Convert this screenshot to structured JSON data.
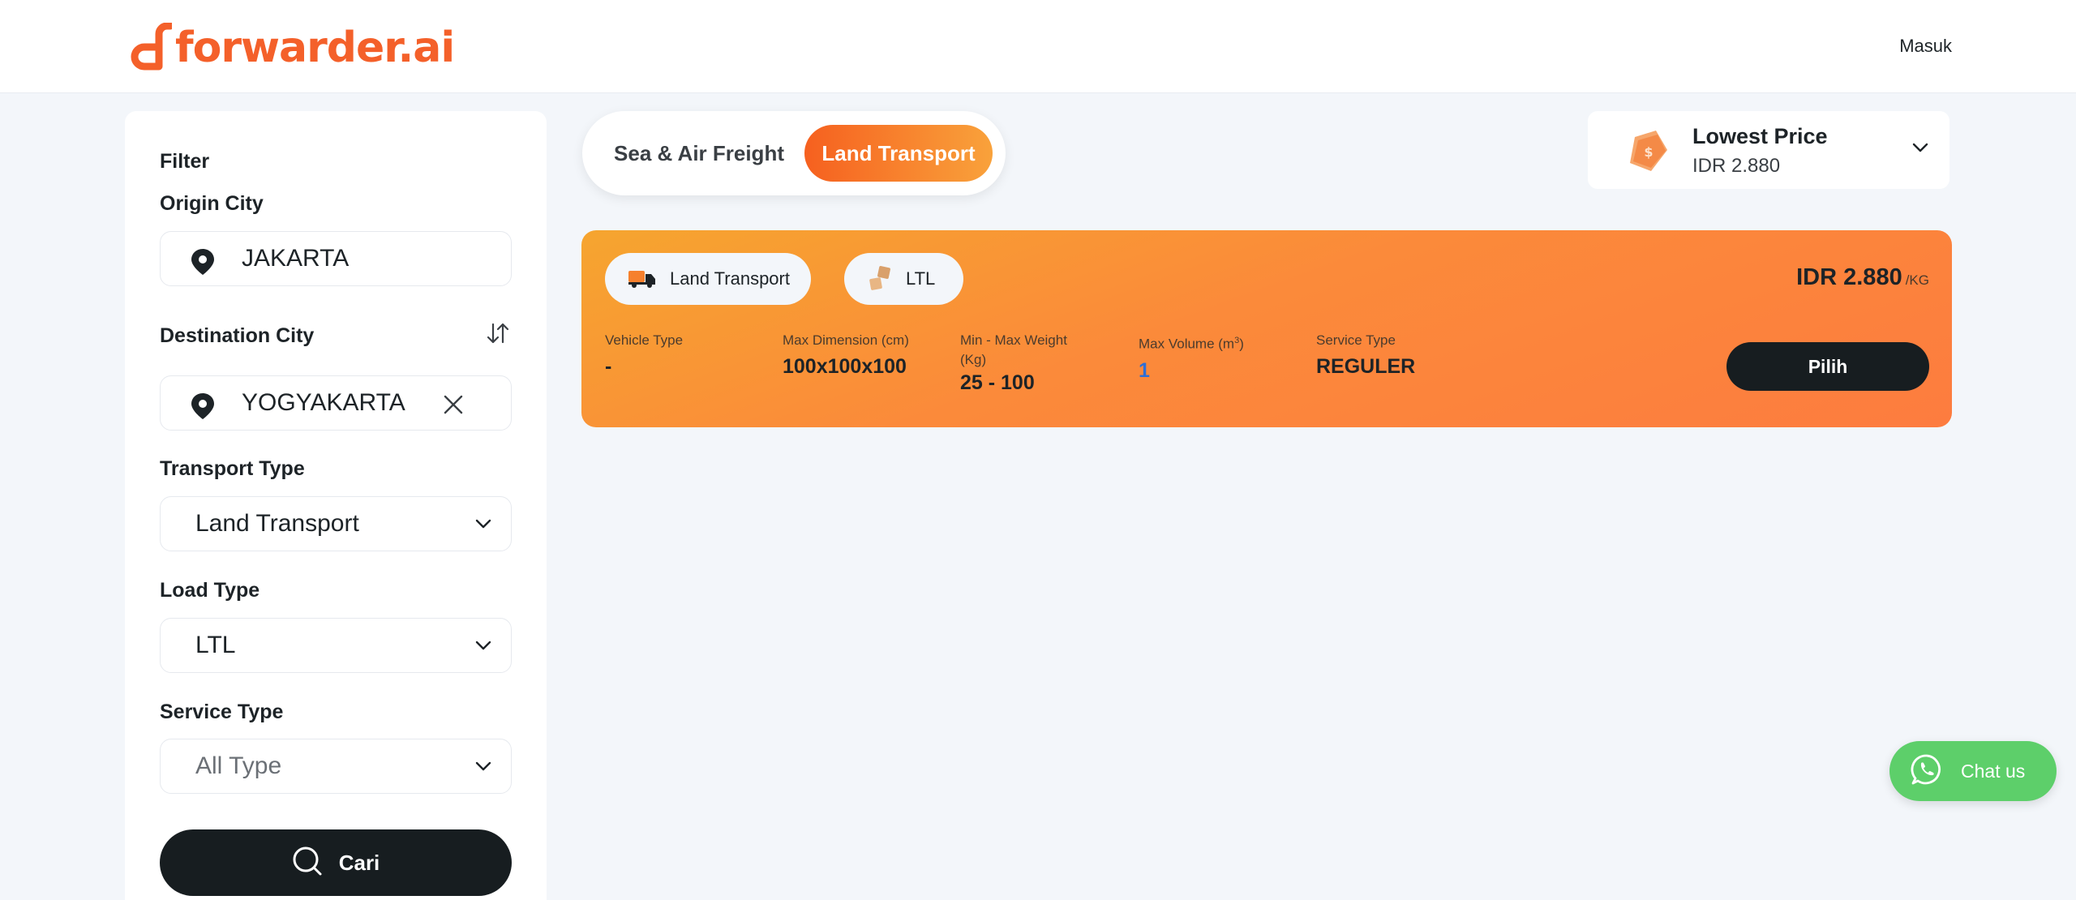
{
  "brand": {
    "logo_text": "forwarder.ai",
    "accent": "#f4602a"
  },
  "header": {
    "login_label": "Masuk"
  },
  "sidebar": {
    "filter_title": "Filter",
    "origin": {
      "label": "Origin City",
      "value": "JAKARTA",
      "icon": "map-pin-icon"
    },
    "destination": {
      "label": "Destination City",
      "value": "YOGYAKARTA",
      "icon": "map-pin-icon"
    },
    "transport": {
      "label": "Transport Type",
      "value": "Land Transport"
    },
    "load": {
      "label": "Load Type",
      "value": "LTL"
    },
    "service": {
      "label": "Service Type",
      "placeholder": "All Type"
    },
    "search_label": "Cari"
  },
  "mode_toggle": {
    "options": [
      "Sea & Air Freight",
      "Land Transport"
    ],
    "active": "Land Transport"
  },
  "sort": {
    "title": "Lowest Price",
    "value": "IDR 2.880"
  },
  "result": {
    "chips": [
      {
        "label": "Land Transport",
        "icon": "truck-icon"
      },
      {
        "label": "LTL",
        "icon": "boxes-icon"
      }
    ],
    "price": "IDR 2.880",
    "price_unit": "/KG",
    "specs": [
      {
        "label": "Vehicle Type",
        "value": "-"
      },
      {
        "label": "Max Dimension (cm)",
        "value": "100x100x100"
      },
      {
        "label": "Min - Max Weight (Kg)",
        "value": "25 - 100"
      },
      {
        "label_prefix": "Max Volume (m",
        "label_sup": "3",
        "label_suffix": ")",
        "value": "1"
      },
      {
        "label": "Service Type",
        "value": "REGULER"
      }
    ],
    "pick_label": "Pilih"
  },
  "chat": {
    "label": "Chat us",
    "color": "#5dcf6a"
  }
}
